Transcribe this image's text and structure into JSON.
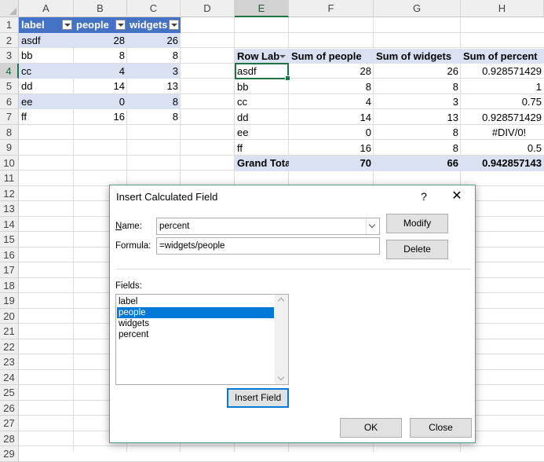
{
  "columns": [
    "A",
    "B",
    "C",
    "D",
    "E",
    "F",
    "G",
    "H"
  ],
  "rows": [
    "1",
    "2",
    "3",
    "4",
    "5",
    "6",
    "7",
    "8",
    "9",
    "10",
    "11",
    "12",
    "13",
    "14",
    "15",
    "16",
    "17",
    "18",
    "19",
    "20",
    "21",
    "22",
    "23",
    "24",
    "25",
    "26",
    "27",
    "28",
    "29"
  ],
  "table": {
    "headers": [
      "label",
      "people",
      "widgets"
    ],
    "rows": [
      [
        "asdf",
        "28",
        "26"
      ],
      [
        "bb",
        "8",
        "8"
      ],
      [
        "cc",
        "4",
        "3"
      ],
      [
        "dd",
        "14",
        "13"
      ],
      [
        "ee",
        "0",
        "8"
      ],
      [
        "ff",
        "16",
        "8"
      ]
    ]
  },
  "pivot": {
    "headers": [
      "Row Lab",
      "Sum of people",
      "Sum of widgets",
      "Sum of percent"
    ],
    "rows": [
      [
        "asdf",
        "28",
        "26",
        "0.928571429"
      ],
      [
        "bb",
        "8",
        "8",
        "1"
      ],
      [
        "cc",
        "4",
        "3",
        "0.75"
      ],
      [
        "dd",
        "14",
        "13",
        "0.928571429"
      ],
      [
        "ee",
        "0",
        "8",
        "#DIV/0!"
      ],
      [
        "ff",
        "16",
        "8",
        "0.5"
      ]
    ],
    "total": [
      "Grand Tota",
      "70",
      "66",
      "0.942857143"
    ]
  },
  "dialog": {
    "title": "Insert Calculated Field",
    "help": "?",
    "close": "✕",
    "name_label": "Name:",
    "name_value": "percent",
    "formula_label": "Formula:",
    "formula_value": "=widgets/people",
    "modify": "Modify",
    "delete": "Delete",
    "fields_label": "Fields:",
    "fields": [
      "label",
      "people",
      "widgets",
      "percent"
    ],
    "selected_field": "people",
    "insert_field": "Insert Field",
    "ok": "OK",
    "close_btn": "Close"
  },
  "colors": {
    "accent": "#217346",
    "table_header": "#4472c4",
    "band": "#d9e1f2",
    "selection": "#0078d7"
  }
}
